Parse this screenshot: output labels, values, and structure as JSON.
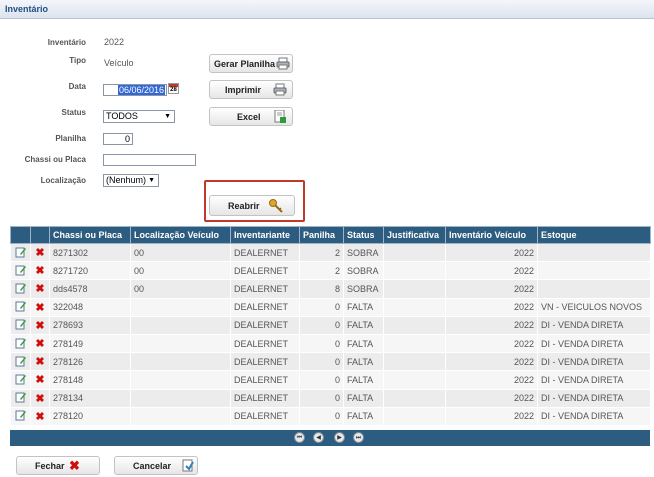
{
  "title": "Inventário",
  "fields": {
    "inventario": {
      "label": "Inventário",
      "value": "2022"
    },
    "tipo": {
      "label": "Tipo",
      "value": "Veículo"
    },
    "data": {
      "label": "Data",
      "value": "06/06/2016",
      "cal_day": "28"
    },
    "status": {
      "label": "Status",
      "value": "TODOS"
    },
    "planilha": {
      "label": "Planilha",
      "value": "0"
    },
    "chassi": {
      "label": "Chassi ou Placa",
      "value": ""
    },
    "localizacao": {
      "label": "Localização",
      "value": "(Nenhum)"
    }
  },
  "buttons": {
    "gerar": "Gerar Planilha",
    "imprimir": "Imprimir",
    "excel": "Excel",
    "reabrir": "Reabrir",
    "fechar": "Fechar",
    "cancelar": "Cancelar"
  },
  "table": {
    "columns": [
      "",
      "",
      "Chassi ou Placa",
      "Localização Veículo",
      "Inventariante",
      "Panilha",
      "Status",
      "Justificativa",
      "Inventário Veículo",
      "Estoque"
    ],
    "rows": [
      {
        "chassi": "8271302",
        "localizacao": "00",
        "inventariante": "DEALERNET",
        "panilha": "2",
        "status": "SOBRA",
        "justificativa": "",
        "inventario": "2022",
        "estoque": ""
      },
      {
        "chassi": "8271720",
        "localizacao": "00",
        "inventariante": "DEALERNET",
        "panilha": "2",
        "status": "SOBRA",
        "justificativa": "",
        "inventario": "2022",
        "estoque": ""
      },
      {
        "chassi": "dds4578",
        "localizacao": "00",
        "inventariante": "DEALERNET",
        "panilha": "8",
        "status": "SOBRA",
        "justificativa": "",
        "inventario": "2022",
        "estoque": ""
      },
      {
        "chassi": "322048",
        "localizacao": "",
        "inventariante": "DEALERNET",
        "panilha": "0",
        "status": "FALTA",
        "justificativa": "",
        "inventario": "2022",
        "estoque": "VN - VEICULOS NOVOS"
      },
      {
        "chassi": "278693",
        "localizacao": "",
        "inventariante": "DEALERNET",
        "panilha": "0",
        "status": "FALTA",
        "justificativa": "",
        "inventario": "2022",
        "estoque": "DI - VENDA DIRETA"
      },
      {
        "chassi": "278149",
        "localizacao": "",
        "inventariante": "DEALERNET",
        "panilha": "0",
        "status": "FALTA",
        "justificativa": "",
        "inventario": "2022",
        "estoque": "DI - VENDA DIRETA"
      },
      {
        "chassi": "278126",
        "localizacao": "",
        "inventariante": "DEALERNET",
        "panilha": "0",
        "status": "FALTA",
        "justificativa": "",
        "inventario": "2022",
        "estoque": "DI - VENDA DIRETA"
      },
      {
        "chassi": "278148",
        "localizacao": "",
        "inventariante": "DEALERNET",
        "panilha": "0",
        "status": "FALTA",
        "justificativa": "",
        "inventario": "2022",
        "estoque": "DI - VENDA DIRETA"
      },
      {
        "chassi": "278134",
        "localizacao": "",
        "inventariante": "DEALERNET",
        "panilha": "0",
        "status": "FALTA",
        "justificativa": "",
        "inventario": "2022",
        "estoque": "DI - VENDA DIRETA"
      },
      {
        "chassi": "278120",
        "localizacao": "",
        "inventariante": "DEALERNET",
        "panilha": "0",
        "status": "FALTA",
        "justificativa": "",
        "inventario": "2022",
        "estoque": "DI - VENDA DIRETA"
      }
    ]
  },
  "icons": {
    "edit": "edit-icon",
    "delete": "delete-icon",
    "printer": "printer-icon",
    "excel": "excel-icon",
    "keys": "keys-icon",
    "close": "close-icon",
    "cancel": "cancel-icon",
    "calendar": "calendar-icon",
    "pager_first": "first-page-icon",
    "pager_prev": "prev-page-icon",
    "pager_next": "next-page-icon",
    "pager_last": "last-page-icon"
  },
  "colors": {
    "header_bg": "#2c5c80",
    "title": "#1f4f82",
    "delete": "#d10e0e",
    "highlight": "#c0392b"
  }
}
